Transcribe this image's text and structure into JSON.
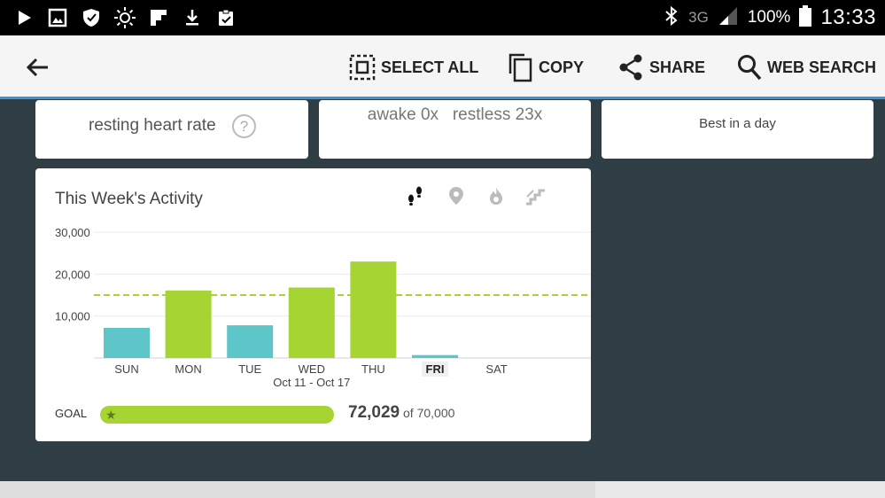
{
  "statusbar": {
    "network": "3G",
    "battery": "100%",
    "time": "13:33"
  },
  "actionbar": {
    "select_all": "SELECT ALL",
    "copy": "COPY",
    "share": "SHARE",
    "web_search": "WEB SEARCH"
  },
  "cards": {
    "heart": {
      "label": "resting heart rate",
      "help": "?"
    },
    "sleep": {
      "line": "awake 0x   restless 23x"
    },
    "best": {
      "line": "Best in a day"
    }
  },
  "activity": {
    "title": "This Week's Activity",
    "date_range": "Oct 11 - Oct 17",
    "goal_label": "GOAL",
    "goal_total": "72,029",
    "goal_of": " of 70,000",
    "goal_progress": 1.0
  },
  "colors": {
    "accent_blue": "#3d8fd6",
    "goal_green": "#a6d432",
    "below_goal_teal": "#5ec6c8",
    "background": "#2f3e44"
  },
  "chart_data": {
    "type": "bar",
    "categories": [
      "SUN",
      "MON",
      "TUE",
      "WED",
      "THU",
      "FRI",
      "SAT"
    ],
    "values": [
      7200,
      16100,
      7800,
      16800,
      23000,
      700,
      0
    ],
    "ylim": [
      0,
      30000
    ],
    "yticks": [
      "30,000",
      "20,000",
      "10,000"
    ],
    "ytick_values": [
      30000,
      20000,
      10000
    ],
    "goal_line": 15000,
    "highlight_category": "FRI",
    "grid": true
  }
}
